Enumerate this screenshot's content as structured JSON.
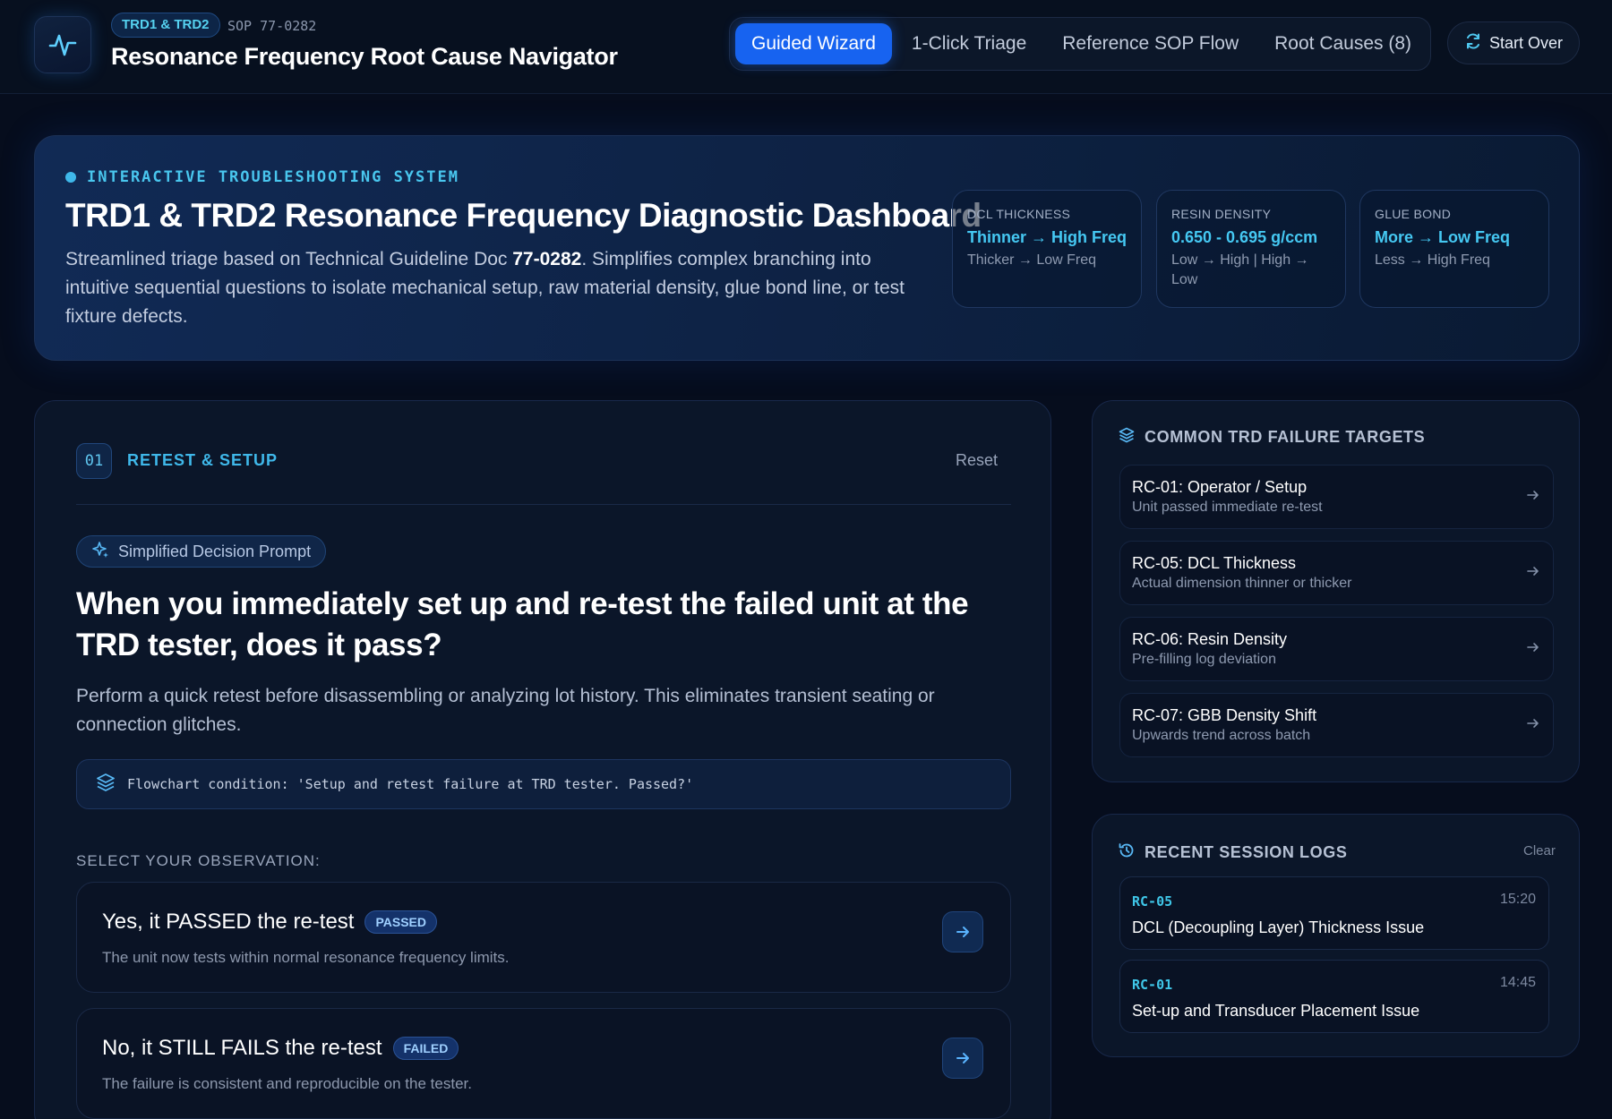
{
  "header": {
    "badge": "TRD1 & TRD2",
    "sop": "SOP 77-0282",
    "title": "Resonance Frequency Root Cause Navigator",
    "tabs": [
      {
        "label": "Guided Wizard",
        "active": true
      },
      {
        "label": "1-Click Triage",
        "active": false
      },
      {
        "label": "Reference SOP Flow",
        "active": false
      },
      {
        "label": "Root Causes (8)",
        "active": false
      }
    ],
    "start_over": "Start Over"
  },
  "hero": {
    "kicker": "INTERACTIVE TROUBLESHOOTING SYSTEM",
    "title": "TRD1 & TRD2 Resonance Frequency Diagnostic Dashboard",
    "desc_before": "Streamlined triage based on Technical Guideline Doc ",
    "desc_doc": "77-0282",
    "desc_after": ". Simplifies complex branching into intuitive sequential questions to isolate mechanical setup, raw material density, glue bond line, or test fixture defects.",
    "stats": [
      {
        "label": "DCL THICKNESS",
        "value": "Thinner → High Freq",
        "sub": "Thicker → Low Freq"
      },
      {
        "label": "RESIN DENSITY",
        "value": "0.650 - 0.695 g/ccm",
        "sub": "Low → High | High → Low"
      },
      {
        "label": "GLUE BOND",
        "value": "More → Low Freq",
        "sub": "Less → High Freq"
      }
    ]
  },
  "wizard": {
    "step_number": "01",
    "step_title": "RETEST & SETUP",
    "reset": "Reset",
    "prompt_pill": "Simplified Decision Prompt",
    "question": "When you immediately set up and re-test the failed unit at the TRD tester, does it pass?",
    "description": "Perform a quick retest before disassembling or analyzing lot history. This eliminates transient seating or connection glitches.",
    "flow_condition": "Flowchart condition: 'Setup and retest failure at TRD tester. Passed?'",
    "select_label": "SELECT YOUR OBSERVATION:",
    "options": [
      {
        "title": "Yes, it PASSED the re-test",
        "badge": "PASSED",
        "desc": "The unit now tests within normal resonance frequency limits."
      },
      {
        "title": "No, it STILL FAILS the re-test",
        "badge": "FAILED",
        "desc": "The failure is consistent and reproducible on the tester."
      }
    ]
  },
  "targets": {
    "heading": "COMMON TRD FAILURE TARGETS",
    "items": [
      {
        "title": "RC-01: Operator / Setup",
        "sub": "Unit passed immediate re-test"
      },
      {
        "title": "RC-05: DCL Thickness",
        "sub": "Actual dimension thinner or thicker"
      },
      {
        "title": "RC-06: Resin Density",
        "sub": "Pre-filling log deviation"
      },
      {
        "title": "RC-07: GBB Density Shift",
        "sub": "Upwards trend across batch"
      }
    ]
  },
  "logs": {
    "heading": "RECENT SESSION LOGS",
    "clear": "Clear",
    "items": [
      {
        "code": "RC-05",
        "time": "15:20",
        "desc": "DCL (Decoupling Layer) Thickness Issue"
      },
      {
        "code": "RC-01",
        "time": "14:45",
        "desc": "Set-up and Transducer Placement Issue"
      }
    ]
  },
  "colors": {
    "background": "#060d1d",
    "accent_blue": "#1763f0",
    "accent_cyan": "#45c8f2"
  }
}
